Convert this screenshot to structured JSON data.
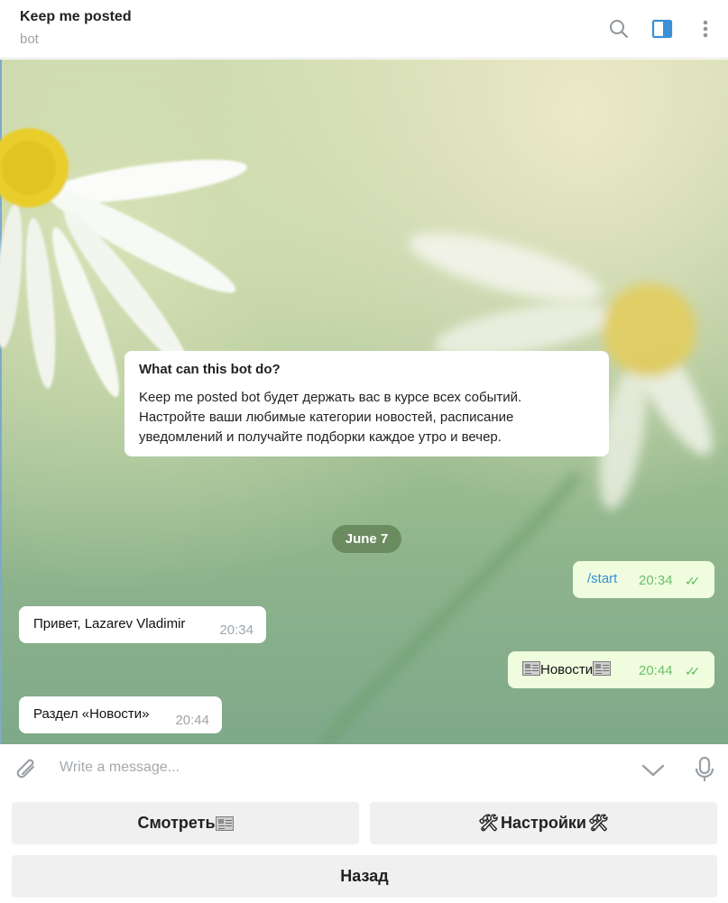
{
  "header": {
    "title": "Keep me posted",
    "subtitle": "bot",
    "icons": [
      "search-icon",
      "sidebar-toggle-icon",
      "more-vertical-icon"
    ]
  },
  "info_card": {
    "title": "What can this bot do?",
    "body_line1": "Keep me posted bot будет держать вас в курсе всех событий.",
    "body_line2": "Настройте ваши любимые категории новостей, расписание",
    "body_line3": "уведомлений и получайте подборки каждое утро и вечер."
  },
  "date_separator": "June 7",
  "messages": [
    {
      "direction": "out",
      "text": "/start",
      "time": "20:34"
    },
    {
      "direction": "in",
      "text": "Привет, Lazarev Vladimir",
      "time": "20:34"
    },
    {
      "direction": "out",
      "text": "Новости",
      "time": "20:44"
    },
    {
      "direction": "in",
      "text": "Раздел «Новости»",
      "time": "20:44"
    }
  ],
  "composer": {
    "placeholder": "Write a message..."
  },
  "keyboard": {
    "view_label": "Смотреть",
    "settings_label": "Настройки",
    "back_label": "Назад"
  },
  "colors": {
    "outgoing_bubble": "#effdde",
    "incoming_bubble": "#ffffff",
    "accent": "#3a8fd6",
    "read_ticks": "#5db85a"
  }
}
